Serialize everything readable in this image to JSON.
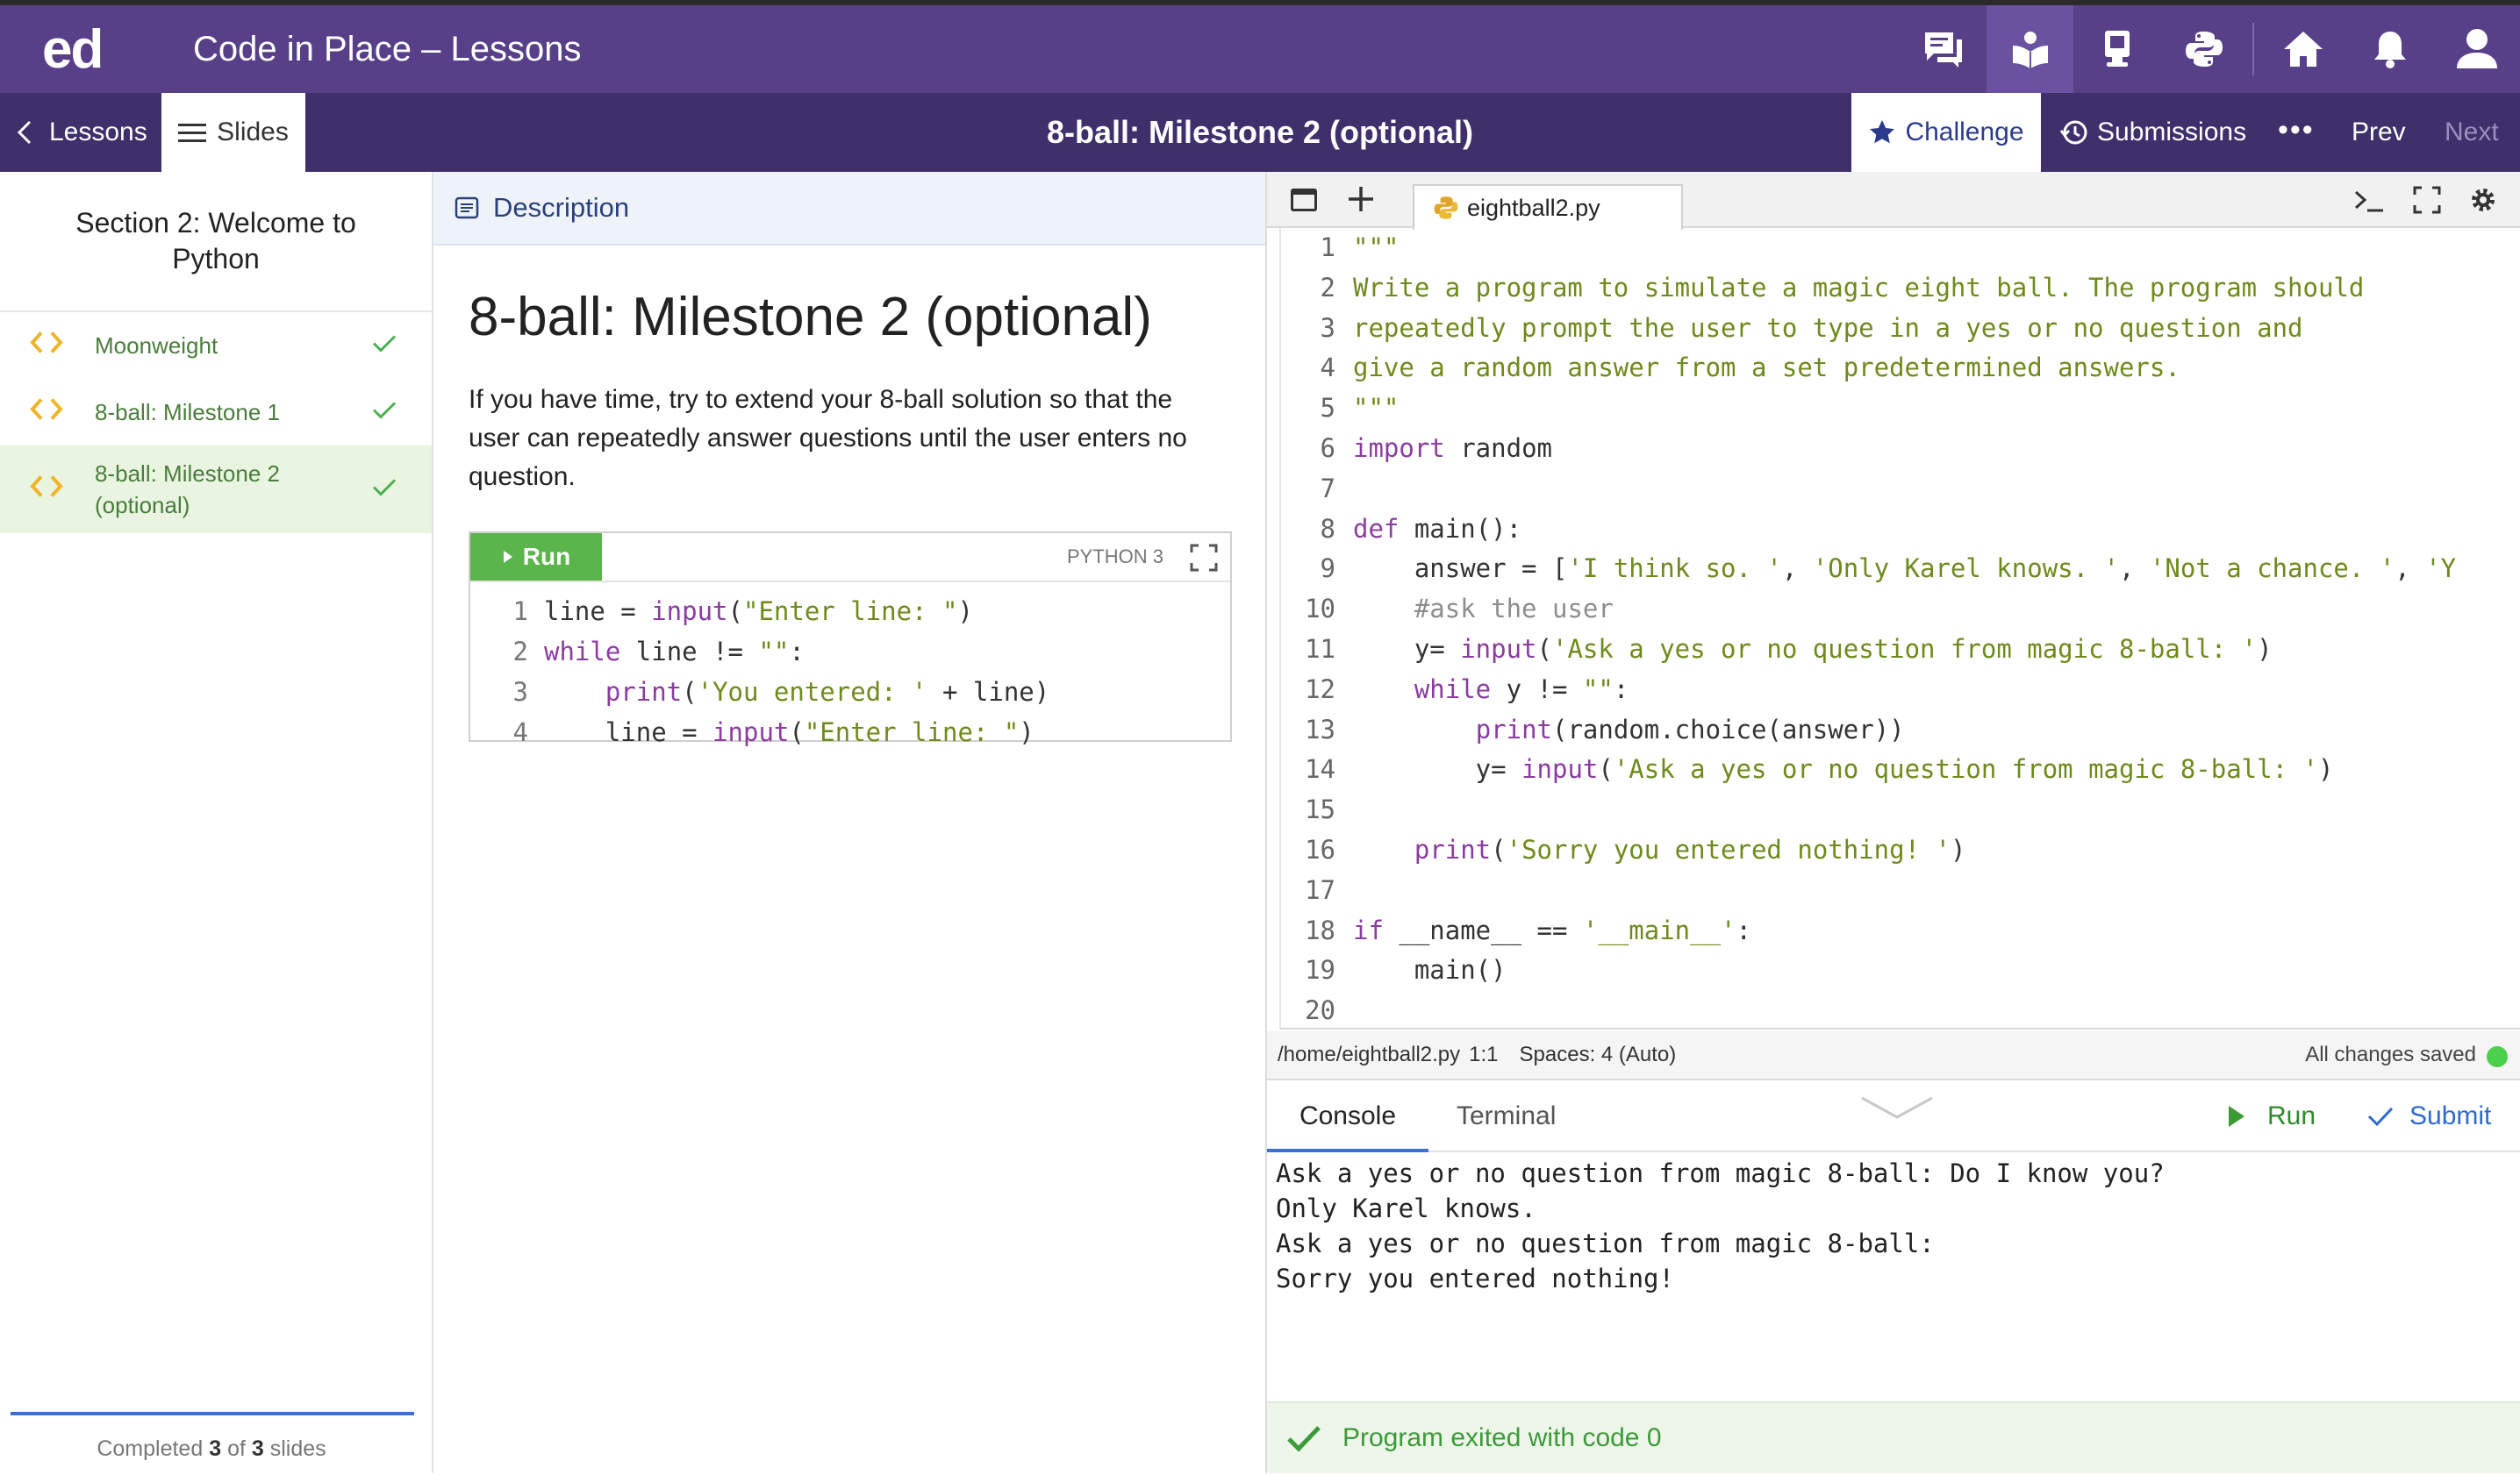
{
  "topbar": {
    "logo": "ed",
    "title": "Code in Place – Lessons"
  },
  "subbar": {
    "lessons": "Lessons",
    "slides": "Slides",
    "title": "8-ball: Milestone 2 (optional)",
    "challenge": "Challenge",
    "submissions": "Submissions",
    "more": "•••",
    "prev": "Prev",
    "next": "Next"
  },
  "sidebar": {
    "section_line1": "Section 2: Welcome to",
    "section_line2": "Python",
    "lessons": [
      {
        "label": "Moonweight"
      },
      {
        "label": "8-ball: Milestone 1"
      },
      {
        "label_line1": "8-ball: Milestone 2",
        "label_line2": "(optional)"
      }
    ],
    "completed_prefix": "Completed",
    "completed_done": "3",
    "completed_of": "of",
    "completed_total": "3",
    "completed_suffix": "slides"
  },
  "description": {
    "header": "Description",
    "heading": "8-ball: Milestone 2 (optional)",
    "body": "If you have time, try to extend your 8-ball solution so that the user can repeatedly answer questions until the user enters no question.",
    "run_label": "Run",
    "language": "PYTHON 3",
    "code_lines": [
      "line = input(\"Enter line: \")",
      "while line != \"\":",
      "    print('You entered: ' + line)",
      "    line = input(\"Enter line: \")"
    ]
  },
  "editor": {
    "filename": "eightball2.py",
    "code_lines": [
      "\"\"\"",
      "Write a program to simulate a magic eight ball. The program should",
      "repeatedly prompt the user to type in a yes or no question and",
      "give a random answer from a set predetermined answers.",
      "\"\"\"",
      "import random",
      "",
      "def main():",
      "    answer = ['I think so. ', 'Only Karel knows. ', 'Not a chance. ', 'Y",
      "    #ask the user",
      "    y= input('Ask a yes or no question from magic 8-ball: ')",
      "    while y != \"\":",
      "        print(random.choice(answer))",
      "        y= input('Ask a yes or no question from magic 8-ball: ')",
      "",
      "    print('Sorry you entered nothing! ')",
      "",
      "if __name__ == '__main__':",
      "    main()",
      ""
    ],
    "status_path": "/home/eightball2.py",
    "status_cursor": "1:1",
    "status_spaces": "Spaces: 4 (Auto)",
    "status_saved": "All changes saved",
    "console_tab": "Console",
    "terminal_tab": "Terminal",
    "run_label": "Run",
    "submit_label": "Submit",
    "console_output": "Ask a yes or no question from magic 8-ball: Do I know you?\nOnly Karel knows.\nAsk a yes or no question from magic 8-ball:\nSorry you entered nothing!",
    "exit_message": "Program exited with code 0"
  },
  "colors": {
    "topbar": "#584089",
    "subbar": "#3f2f6b",
    "accent_blue": "#3b6fd4",
    "success_green": "#5ab54a"
  }
}
